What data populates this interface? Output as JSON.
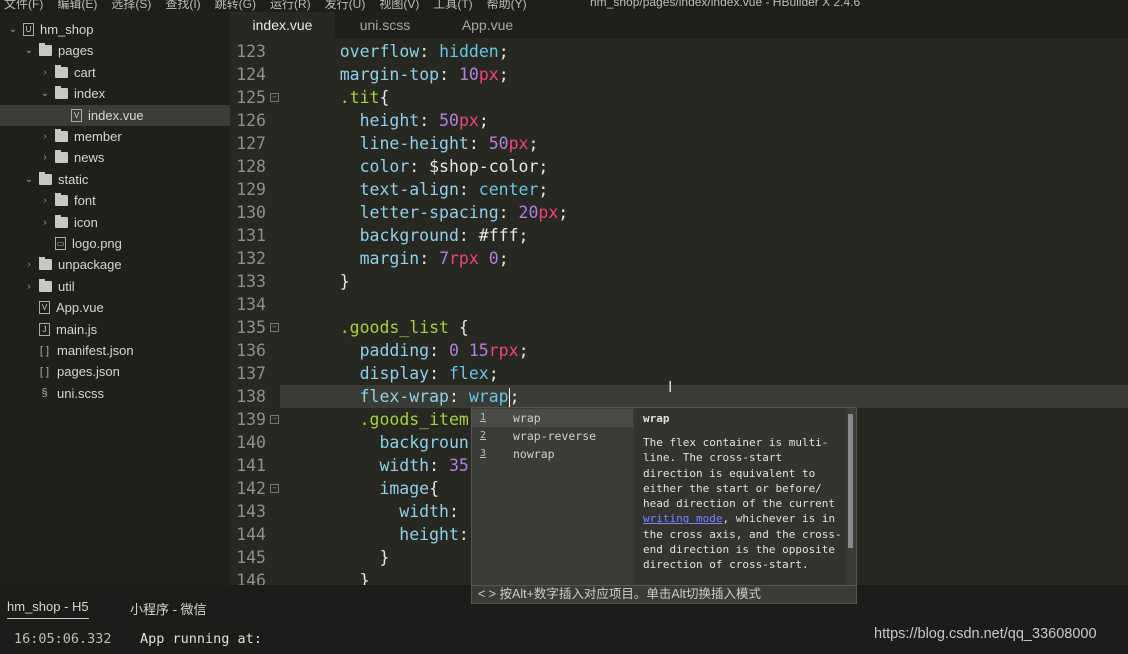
{
  "menubar": {
    "items": [
      "文件(F)",
      "编辑(E)",
      "选择(S)",
      "查找(I)",
      "跳转(G)",
      "运行(R)",
      "发行(U)",
      "视图(V)",
      "工具(T)",
      "帮助(Y)"
    ],
    "window_title": "hm_shop/pages/index/index.vue - HBuilder X 2.4.6"
  },
  "tabs": [
    {
      "label": "index.vue",
      "active": true
    },
    {
      "label": "uni.scss",
      "active": false
    },
    {
      "label": "App.vue",
      "active": false
    }
  ],
  "sidebar": {
    "items": [
      {
        "label": "hm_shop",
        "icon": "project-icon",
        "depth": 0,
        "expanded": true
      },
      {
        "label": "pages",
        "icon": "folder-open-icon",
        "depth": 1,
        "expanded": true
      },
      {
        "label": "cart",
        "icon": "folder-icon",
        "depth": 2,
        "expanded": false
      },
      {
        "label": "index",
        "icon": "folder-open-icon",
        "depth": 2,
        "expanded": true
      },
      {
        "label": "index.vue",
        "icon": "vue-file-icon",
        "depth": 3,
        "selected": true
      },
      {
        "label": "member",
        "icon": "folder-icon",
        "depth": 2,
        "expanded": false
      },
      {
        "label": "news",
        "icon": "folder-icon",
        "depth": 2,
        "expanded": false
      },
      {
        "label": "static",
        "icon": "folder-open-icon",
        "depth": 1,
        "expanded": true
      },
      {
        "label": "font",
        "icon": "folder-icon",
        "depth": 2,
        "expanded": false
      },
      {
        "label": "icon",
        "icon": "folder-icon",
        "depth": 2,
        "expanded": false
      },
      {
        "label": "logo.png",
        "icon": "image-file-icon",
        "depth": 2
      },
      {
        "label": "unpackage",
        "icon": "folder-icon",
        "depth": 1,
        "expanded": false
      },
      {
        "label": "util",
        "icon": "folder-icon",
        "depth": 1,
        "expanded": false
      },
      {
        "label": "App.vue",
        "icon": "vue-file-icon",
        "depth": 1
      },
      {
        "label": "main.js",
        "icon": "js-file-icon",
        "depth": 1
      },
      {
        "label": "manifest.json",
        "icon": "json-file-icon",
        "depth": 1
      },
      {
        "label": "pages.json",
        "icon": "json-file-icon",
        "depth": 1
      },
      {
        "label": "uni.scss",
        "icon": "scss-file-icon",
        "depth": 1
      }
    ]
  },
  "editor": {
    "current_line": "138",
    "lines": [
      {
        "num": "123",
        "indent": 4,
        "tokens": [
          [
            "p",
            "overflow"
          ],
          [
            "w",
            ": "
          ],
          [
            "v",
            "hidden"
          ],
          [
            "w",
            ";"
          ]
        ]
      },
      {
        "num": "124",
        "indent": 4,
        "tokens": [
          [
            "p",
            "margin-top"
          ],
          [
            "w",
            ": "
          ],
          [
            "n",
            "10"
          ],
          [
            "u",
            "px"
          ],
          [
            "w",
            ";"
          ]
        ]
      },
      {
        "num": "125",
        "indent": 4,
        "fold": true,
        "tokens": [
          [
            "s",
            ".tit"
          ],
          [
            "w",
            "{"
          ]
        ]
      },
      {
        "num": "126",
        "indent": 6,
        "tokens": [
          [
            "p",
            "height"
          ],
          [
            "w",
            ": "
          ],
          [
            "n",
            "50"
          ],
          [
            "u",
            "px"
          ],
          [
            "w",
            ";"
          ]
        ]
      },
      {
        "num": "127",
        "indent": 6,
        "tokens": [
          [
            "p",
            "line-height"
          ],
          [
            "w",
            ": "
          ],
          [
            "n",
            "50"
          ],
          [
            "u",
            "px"
          ],
          [
            "w",
            ";"
          ]
        ]
      },
      {
        "num": "128",
        "indent": 6,
        "tokens": [
          [
            "p",
            "color"
          ],
          [
            "w",
            ": $shop-color;"
          ]
        ]
      },
      {
        "num": "129",
        "indent": 6,
        "tokens": [
          [
            "p",
            "text-align"
          ],
          [
            "w",
            ": "
          ],
          [
            "v",
            "center"
          ],
          [
            "w",
            ";"
          ]
        ]
      },
      {
        "num": "130",
        "indent": 6,
        "tokens": [
          [
            "p",
            "letter-spacing"
          ],
          [
            "w",
            ": "
          ],
          [
            "n",
            "20"
          ],
          [
            "u",
            "px"
          ],
          [
            "w",
            ";"
          ]
        ]
      },
      {
        "num": "131",
        "indent": 6,
        "tokens": [
          [
            "p",
            "background"
          ],
          [
            "w",
            ": #fff;"
          ]
        ]
      },
      {
        "num": "132",
        "indent": 6,
        "tokens": [
          [
            "p",
            "margin"
          ],
          [
            "w",
            ": "
          ],
          [
            "n",
            "7"
          ],
          [
            "u",
            "rpx"
          ],
          [
            "w",
            " "
          ],
          [
            "n",
            "0"
          ],
          [
            "w",
            ";"
          ]
        ]
      },
      {
        "num": "133",
        "indent": 4,
        "tokens": [
          [
            "w",
            "}"
          ]
        ]
      },
      {
        "num": "134",
        "indent": 0,
        "tokens": []
      },
      {
        "num": "135",
        "indent": 4,
        "fold": true,
        "tokens": [
          [
            "s",
            ".goods_list"
          ],
          [
            "w",
            " {"
          ]
        ]
      },
      {
        "num": "136",
        "indent": 6,
        "tokens": [
          [
            "p",
            "padding"
          ],
          [
            "w",
            ": "
          ],
          [
            "n",
            "0"
          ],
          [
            "w",
            " "
          ],
          [
            "n",
            "15"
          ],
          [
            "u",
            "rpx"
          ],
          [
            "w",
            ";"
          ]
        ]
      },
      {
        "num": "137",
        "indent": 6,
        "tokens": [
          [
            "p",
            "display"
          ],
          [
            "w",
            ": "
          ],
          [
            "v",
            "flex"
          ],
          [
            "w",
            ";"
          ]
        ]
      },
      {
        "num": "138",
        "indent": 6,
        "tokens": [
          [
            "p",
            "flex-wrap"
          ],
          [
            "w",
            ": "
          ],
          [
            "v",
            "wrap"
          ],
          [
            "caret",
            ""
          ],
          [
            "w",
            ";"
          ]
        ]
      },
      {
        "num": "139",
        "indent": 6,
        "fold": true,
        "tokens": [
          [
            "s",
            ".goods_item"
          ]
        ]
      },
      {
        "num": "140",
        "indent": 8,
        "tokens": [
          [
            "p",
            "backgroun"
          ]
        ]
      },
      {
        "num": "141",
        "indent": 8,
        "tokens": [
          [
            "p",
            "width"
          ],
          [
            "w",
            ": "
          ],
          [
            "n",
            "35"
          ]
        ]
      },
      {
        "num": "142",
        "indent": 8,
        "fold": true,
        "tokens": [
          [
            "p",
            "image"
          ],
          [
            "w",
            "{"
          ]
        ]
      },
      {
        "num": "143",
        "indent": 10,
        "tokens": [
          [
            "p",
            "width"
          ],
          [
            "w",
            ":"
          ]
        ]
      },
      {
        "num": "144",
        "indent": 10,
        "tokens": [
          [
            "p",
            "height"
          ],
          [
            "w",
            ":"
          ]
        ]
      },
      {
        "num": "145",
        "indent": 8,
        "tokens": [
          [
            "w",
            "}"
          ]
        ]
      },
      {
        "num": "146",
        "indent": 6,
        "tokens": [
          [
            "w",
            "}"
          ]
        ]
      }
    ]
  },
  "autocomplete": {
    "options": [
      {
        "num": "1",
        "label": "wrap",
        "selected": true
      },
      {
        "num": "2",
        "label": "wrap-reverse"
      },
      {
        "num": "3",
        "label": "nowrap"
      }
    ],
    "doc_title": "wrap",
    "doc_before": "The flex container is multi-line. The cross-start direction is equivalent to either the start or before/ head direction of the current ",
    "doc_link": "writing mode",
    "doc_after": ", whichever is in the cross axis, and the cross-end direction is the opposite direction of cross-start.",
    "footer": "< > 按Alt+数字插入对应项目。单击Alt切换插入模式"
  },
  "panel": {
    "tabs": [
      {
        "label": "hm_shop - H5",
        "active": true
      },
      {
        "label": "小程序 - 微信",
        "active": false
      }
    ],
    "console": {
      "timestamp": "16:05:06.332",
      "message": "App running at:"
    }
  },
  "watermark": "https://blog.csdn.net/qq_33608000",
  "colors": {
    "background": "#272822",
    "property": "#8fd0ea",
    "number": "#b57fe0",
    "unit": "#f0427a",
    "selector": "#a6d23a",
    "link": "#7b83ff"
  }
}
